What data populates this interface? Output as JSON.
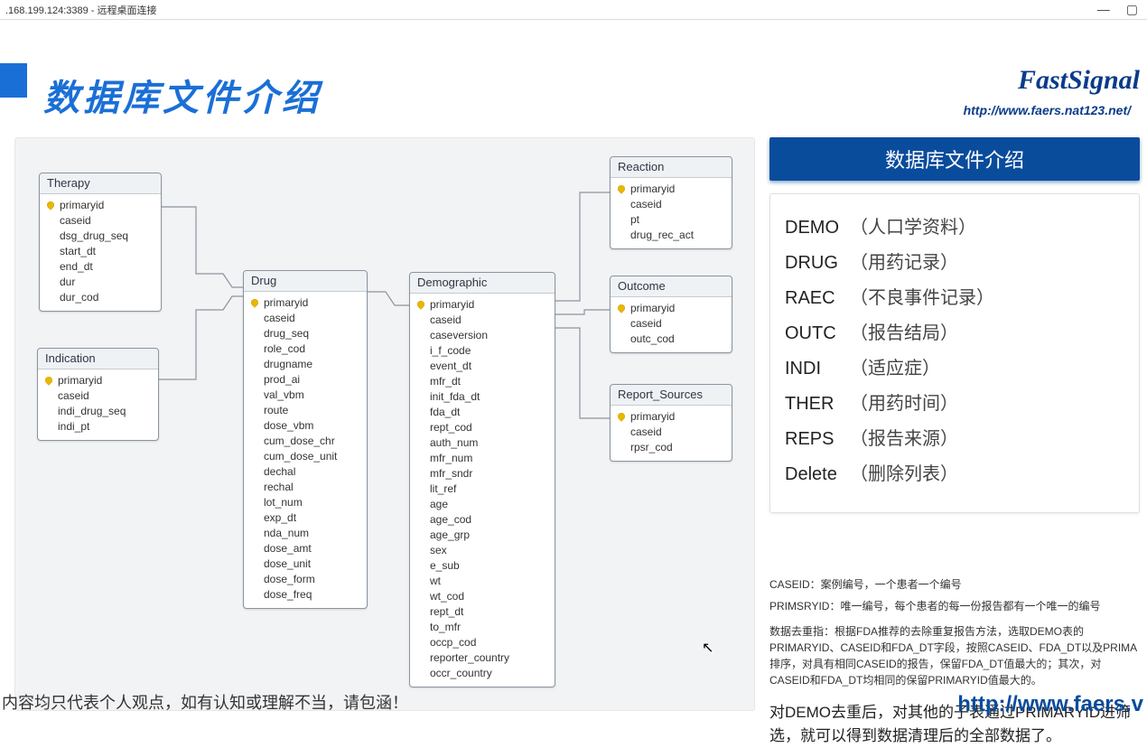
{
  "window": {
    "title": ".168.199.124:3389 - 远程桌面连接",
    "min": "—",
    "max": "▢"
  },
  "page": {
    "title": "数据库文件介绍",
    "brand": "FastSignal",
    "brandurl": "http://www.faers.nat123.net/"
  },
  "tables": {
    "therapy": {
      "name": "Therapy",
      "fields": [
        "primaryid",
        "caseid",
        "dsg_drug_seq",
        "start_dt",
        "end_dt",
        "dur",
        "dur_cod"
      ]
    },
    "indication": {
      "name": "Indication",
      "fields": [
        "primaryid",
        "caseid",
        "indi_drug_seq",
        "indi_pt"
      ]
    },
    "drug": {
      "name": "Drug",
      "fields": [
        "primaryid",
        "caseid",
        "drug_seq",
        "role_cod",
        "drugname",
        "prod_ai",
        "val_vbm",
        "route",
        "dose_vbm",
        "cum_dose_chr",
        "cum_dose_unit",
        "dechal",
        "rechal",
        "lot_num",
        "exp_dt",
        "nda_num",
        "dose_amt",
        "dose_unit",
        "dose_form",
        "dose_freq"
      ]
    },
    "demographic": {
      "name": "Demographic",
      "fields": [
        "primaryid",
        "caseid",
        "caseversion",
        "i_f_code",
        "event_dt",
        "mfr_dt",
        "init_fda_dt",
        "fda_dt",
        "rept_cod",
        "auth_num",
        "mfr_num",
        "mfr_sndr",
        "lit_ref",
        "age",
        "age_cod",
        "age_grp",
        "sex",
        "e_sub",
        "wt",
        "wt_cod",
        "rept_dt",
        "to_mfr",
        "occp_cod",
        "reporter_country",
        "occr_country"
      ]
    },
    "reaction": {
      "name": "Reaction",
      "fields": [
        "primaryid",
        "caseid",
        "pt",
        "drug_rec_act"
      ]
    },
    "outcome": {
      "name": "Outcome",
      "fields": [
        "primaryid",
        "caseid",
        "outc_cod"
      ]
    },
    "report_sources": {
      "name": "Report_Sources",
      "fields": [
        "primaryid",
        "caseid",
        "rpsr_cod"
      ]
    }
  },
  "right": {
    "title": "数据库文件介绍",
    "items": [
      {
        "key": "DEMO",
        "desc": "（人口学资料）"
      },
      {
        "key": "DRUG",
        "desc": "（用药记录）"
      },
      {
        "key": "RAEC",
        "desc": "（不良事件记录）"
      },
      {
        "key": "OUTC",
        "desc": "（报告结局）"
      },
      {
        "key": "INDI",
        "desc": "（适应症）"
      },
      {
        "key": "THER",
        "desc": "（用药时间）"
      },
      {
        "key": "REPS",
        "desc": "（报告来源）"
      },
      {
        "key": "Delete",
        "desc": "（删除列表）"
      }
    ],
    "notes": [
      "CASEID：案例编号，一个患者一个编号",
      "PRIMSRYID：唯一编号，每个患者的每一份报告都有一个唯一的编号",
      "数据去重指：根据FDA推荐的去除重复报告方法，选取DEMO表的PRIMARYID、CASEID和FDA_DT字段，按照CASEID、FDA_DT以及PRIMA排序，对具有相同CASEID的报告，保留FDA_DT值最大的；其次，对CASEID和FDA_DT均相同的保留PRIMARYID值最大的。"
    ],
    "msg": "对DEMO去重后，对其他的子表通过PRIMARYID进筛选，就可以得到数据清理后的全部数据了。"
  },
  "footer": {
    "left": "内容均只代表个人观点，如有认知或理解不当，请包涵！",
    "right": "http://www.faers.v"
  }
}
